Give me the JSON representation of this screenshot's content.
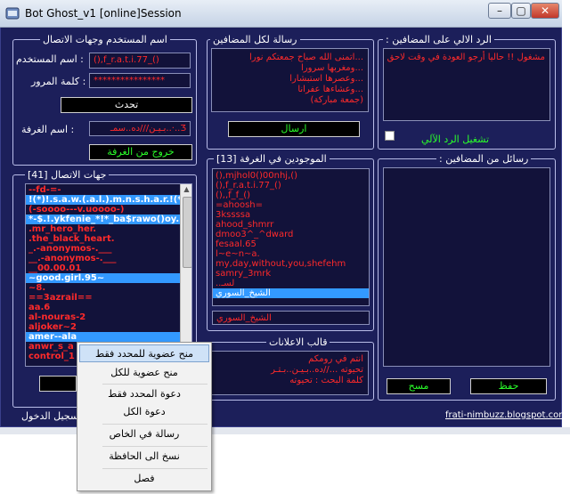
{
  "window": {
    "title": "Bot Ghost_v1 [online]Session",
    "minimize": "–",
    "maximize": "▢",
    "close": "✕"
  },
  "login": {
    "legend": "اسم المستخدم وجهات الاتصال",
    "username_label": "اسم المستخدم :",
    "username_value": "(),f_r.a.t.i.77_()",
    "password_label": "كلمة المرور :",
    "password_value": "****************",
    "connect_button": "تحدث",
    "room_label": "اسم الغرفة :",
    "room_value": "Ʒ..·..بـيـن///ده..سمـ",
    "leave_button": "خروج من الغرفة"
  },
  "contacts": {
    "legend": "جهات الاتصال [41]",
    "items": [
      {
        "text": "--fd-=-",
        "selected": false
      },
      {
        "text": "!(*)!.s.a.w.(.a.l.).m.n.s.h.a.r.!(*)!",
        "selected": true
      },
      {
        "text": "(-soooo---v.uoooo-)",
        "selected": false
      },
      {
        "text": "*-$.!.ykfenie_*!*_ba$rawo()oy.!.$",
        "selected": true
      },
      {
        "text": ".mr_hero_her.",
        "selected": false
      },
      {
        "text": ".the_black_heart.",
        "selected": false
      },
      {
        "text": "_.-anonymos-.___",
        "selected": false
      },
      {
        "text": "__.-anonymos-.___",
        "selected": false
      },
      {
        "text": "__00.00.01",
        "selected": false
      },
      {
        "text": "~good.girl.95~",
        "selected": true
      },
      {
        "text": "~8.",
        "selected": false
      },
      {
        "text": "==3azrail==",
        "selected": false
      },
      {
        "text": "aa.6",
        "selected": false
      },
      {
        "text": "al-nouras-2",
        "selected": false
      },
      {
        "text": "aljoker~2",
        "selected": false
      },
      {
        "text": "amer--ala",
        "selected": true
      },
      {
        "text": "anwr_s_a",
        "selected": false
      },
      {
        "text": "control_1",
        "selected": false
      }
    ],
    "register_text": "تسجيل الدخول"
  },
  "context_menu": {
    "items": [
      {
        "label": "منح عضوية للمحدد فقط",
        "highlighted": true
      },
      {
        "label": "منح عضوية للكل",
        "highlighted": false
      },
      {
        "label": "دعوة المحدد فقط",
        "highlighted": false
      },
      {
        "label": "دعوة الكل",
        "highlighted": false
      },
      {
        "label": "رسالة في الخاص",
        "highlighted": false
      },
      {
        "label": "نسخ الى الحافظة",
        "highlighted": false
      },
      {
        "label": "فصل",
        "highlighted": false
      }
    ]
  },
  "broadcast": {
    "legend": "رسالة لكل المضافين",
    "lines": [
      "...اتمنى الله صباح جمعتكم نورا",
      "...ومغربها سرورا",
      "...وعصرها استبشارا",
      "...وعشاءها عفرانا",
      "(جمعة مباركة)"
    ],
    "send_button": "ارسال"
  },
  "room_members": {
    "legend": "الموجودين في الغرفة [13]",
    "items": [
      {
        "text": "(),mjhol0()00nhj,()",
        "selected": false
      },
      {
        "text": "(),f_r.a.t.i.77_()",
        "selected": false
      },
      {
        "text": "(),,f_f_()",
        "selected": false
      },
      {
        "text": "=ahoosh=",
        "selected": false
      },
      {
        "text": "3kssssa",
        "selected": false
      },
      {
        "text": "ahood_shmrr",
        "selected": false
      },
      {
        "text": "dmoo3^_^dward",
        "selected": false
      },
      {
        "text": "fesaal.65",
        "selected": false
      },
      {
        "text": "l~e~n~a.",
        "selected": false
      },
      {
        "text": "my,day,without,you,shefehm",
        "selected": false
      },
      {
        "text": "samry_3mrk",
        "selected": false
      },
      {
        "text": "..لسـ",
        "selected": false
      },
      {
        "text": "الشيخ_السوري",
        "selected": true
      }
    ],
    "status_value": "الشيخ_السوري"
  },
  "auto_reply": {
    "legend": ": الرد الالي على المضافين",
    "text": "مشغول !! حاليا أرجو العودة في وقت لاحق",
    "checkbox_label": "تشغيل الرد الآلي"
  },
  "ads": {
    "legend": "قالب الاعلانات",
    "lines": [
      "انتم في رومكم",
      "تحيوته ...//ده..بـيـن..بـتـر",
      "كلمة البحث : تحيوته"
    ]
  },
  "received": {
    "legend": ": رسائل من المضافين",
    "clear_button": "مسح",
    "save_button": "حفظ"
  },
  "footer": {
    "link": "frati-nimbuzz.blogspot.com"
  }
}
